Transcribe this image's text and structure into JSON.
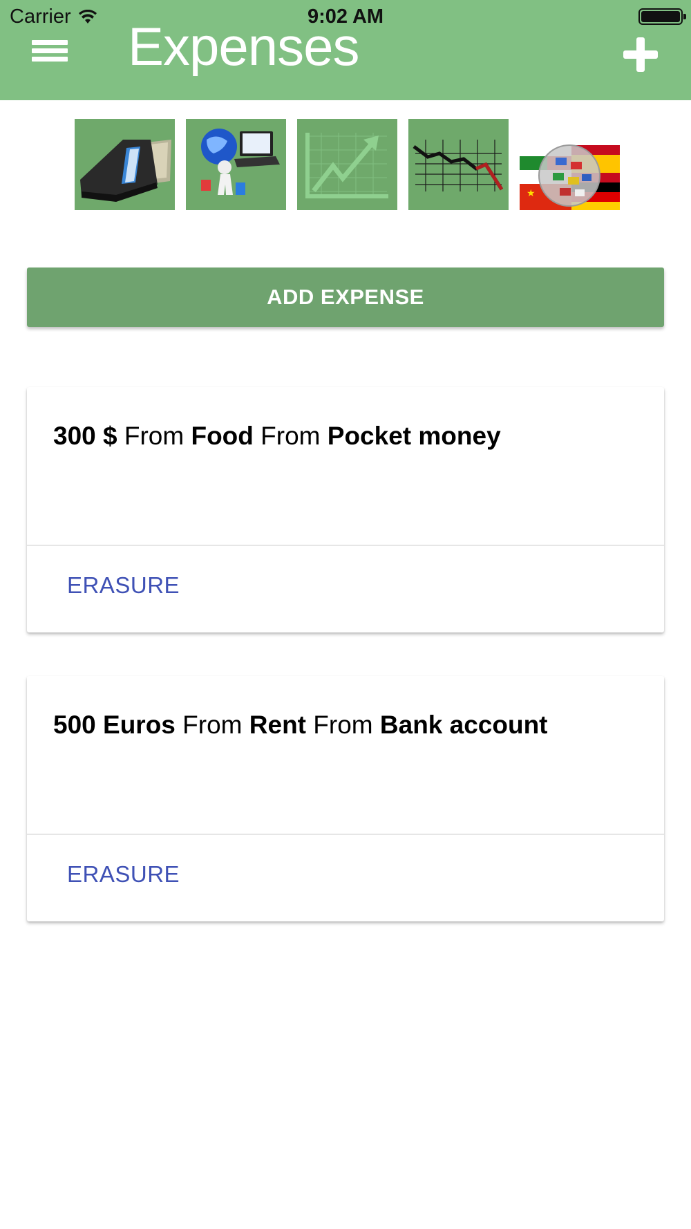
{
  "status_bar": {
    "carrier": "Carrier",
    "time": "9:02 AM"
  },
  "header": {
    "title": "Expenses",
    "menu_icon": "hamburger-menu-icon",
    "add_icon": "plus-icon",
    "background_color": "#81c083"
  },
  "thumbnails": [
    {
      "name": "wallet-icon"
    },
    {
      "name": "shopping-globe-icon"
    },
    {
      "name": "rising-chart-icon"
    },
    {
      "name": "falling-chart-icon"
    },
    {
      "name": "flags-globe-icon"
    }
  ],
  "add_expense_button": {
    "label": "ADD EXPENSE",
    "color": "#6fa36f"
  },
  "expenses": [
    {
      "amount": "300 $",
      "from_word_1": "From",
      "category": "Food",
      "from_word_2": "From",
      "source": "Pocket money",
      "action_label": "ERASURE"
    },
    {
      "amount": "500 Euros",
      "from_word_1": "From",
      "category": "Rent",
      "from_word_2": "From",
      "source": "Bank account",
      "action_label": "ERASURE"
    }
  ],
  "colors": {
    "accent": "#3f51b5"
  }
}
